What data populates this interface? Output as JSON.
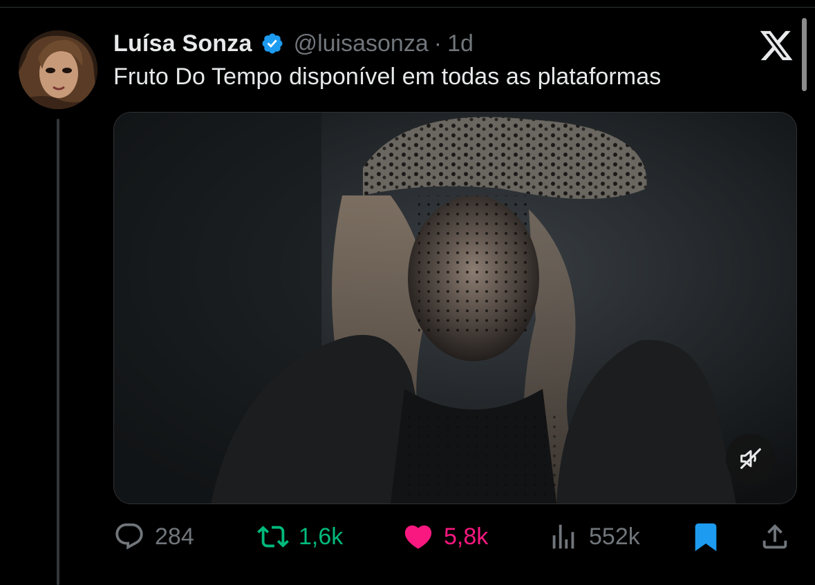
{
  "tweet": {
    "display_name": "Luísa Sonza",
    "handle": "@luisasonza",
    "separator": "·",
    "time": "1d",
    "text": "Fruto Do Tempo disponível em todas as plataformas",
    "verified_badge_icon": "verified-badge-icon",
    "platform_logo_icon": "x-logo-icon"
  },
  "media": {
    "type": "video",
    "mute_icon": "speaker-muted-icon"
  },
  "actions": {
    "replies": "284",
    "reposts": "1,6k",
    "likes": "5,8k",
    "views": "552k",
    "reply_icon": "reply-icon",
    "repost_icon": "repost-icon",
    "like_icon": "heart-icon",
    "views_icon": "views-icon",
    "bookmark_icon": "bookmark-icon",
    "share_icon": "share-icon"
  },
  "colors": {
    "background": "#000000",
    "text_primary": "#e7e9ea",
    "text_secondary": "#71767b",
    "verified": "#1d9bf0",
    "repost_active": "#00ba7c",
    "like_active": "#f91880",
    "bookmark_active": "#1d9bf0"
  }
}
